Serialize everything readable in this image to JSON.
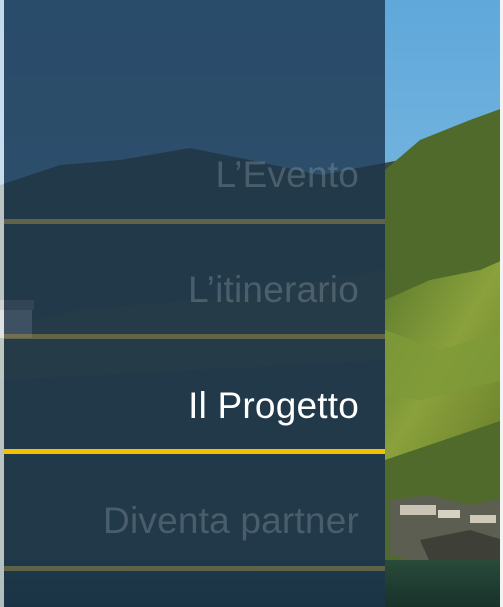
{
  "menu": {
    "items": [
      {
        "label": "L’Evento",
        "active": false
      },
      {
        "label": "L’itinerario",
        "active": false
      },
      {
        "label": "Il Progetto",
        "active": true
      },
      {
        "label": "Diventa partner",
        "active": false
      }
    ]
  },
  "colors": {
    "overlay": "#1b344e",
    "accent": "#f2c200",
    "active_text": "#ffffff",
    "inactive_text": "#8e99a4"
  }
}
